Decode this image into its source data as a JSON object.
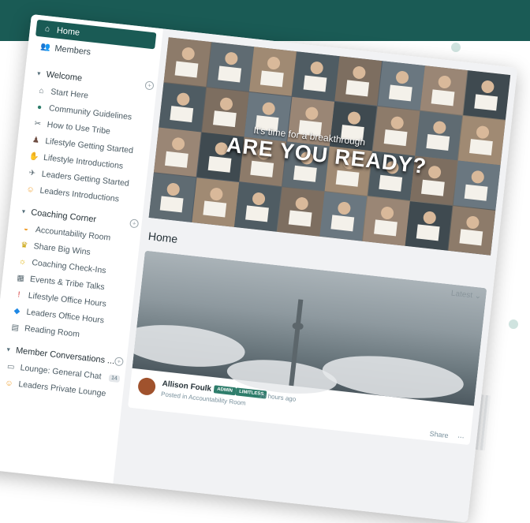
{
  "nav": {
    "home_label": "Home",
    "members_label": "Members"
  },
  "sections": [
    {
      "title": "Welcome",
      "channels": [
        {
          "label": "Start Here",
          "icon": "house-icon"
        },
        {
          "label": "Community Guidelines",
          "icon": "globe-icon"
        },
        {
          "label": "How to Use Tribe",
          "icon": "tools-icon"
        },
        {
          "label": "Lifestyle Getting Started",
          "icon": "runner-icon"
        },
        {
          "label": "Lifestyle Introductions",
          "icon": "wave-icon"
        },
        {
          "label": "Leaders Getting Started",
          "icon": "plane-icon"
        },
        {
          "label": "Leaders Introductions",
          "icon": "smile-icon"
        }
      ]
    },
    {
      "title": "Coaching Corner",
      "channels": [
        {
          "label": "Accountability Room",
          "icon": "megaphone-icon"
        },
        {
          "label": "Share Big Wins",
          "icon": "trophy-icon"
        },
        {
          "label": "Coaching Check-Ins",
          "icon": "lightbulb-icon"
        },
        {
          "label": "Events & Tribe Talks",
          "icon": "calendar-icon"
        },
        {
          "label": "Lifestyle Office Hours",
          "icon": "exclamation-icon"
        },
        {
          "label": "Leaders Office Hours",
          "icon": "diamond-icon"
        },
        {
          "label": "Reading Room",
          "icon": "book-icon"
        }
      ]
    },
    {
      "title": "Member Conversations ...",
      "channels": [
        {
          "label": "Lounge: General Chat",
          "icon": "chat-icon",
          "count": "14"
        },
        {
          "label": "Leaders Private Lounge",
          "icon": "smile-icon"
        }
      ]
    }
  ],
  "banner": {
    "subtitle": "It's time for a breakthrough",
    "headline": "ARE YOU READY?"
  },
  "main": {
    "title": "Home",
    "sort_label": "Latest"
  },
  "post": {
    "author": "Allison Foulk",
    "tags": [
      "ADMIN",
      "LIMITLESS"
    ],
    "time": "16 hours ago",
    "posted_in": "Posted in Accountability Room",
    "share_label": "Share",
    "more_label": "..."
  },
  "colors": {
    "brand": "#1a5b55",
    "tag": "#2e7d6b"
  }
}
